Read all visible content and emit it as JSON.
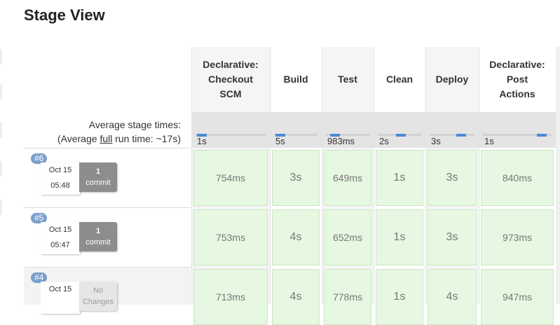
{
  "page": {
    "title": "Stage View"
  },
  "average": {
    "line1": "Average stage times:",
    "line2_pre": "(Average ",
    "line2_link": "full",
    "line2_post": " run time: ~17s)"
  },
  "stages": [
    {
      "name_lines": [
        "Declarative:",
        "Checkout",
        "SCM"
      ],
      "avg": "1s"
    },
    {
      "name_lines": [
        "Build"
      ],
      "avg": "5s"
    },
    {
      "name_lines": [
        "Test"
      ],
      "avg": "983ms"
    },
    {
      "name_lines": [
        "Clean"
      ],
      "avg": "2s"
    },
    {
      "name_lines": [
        "Deploy"
      ],
      "avg": "3s"
    },
    {
      "name_lines": [
        "Declarative:",
        "Post",
        "Actions"
      ],
      "avg": "1s"
    }
  ],
  "builds": [
    {
      "number": "#6",
      "date": "Oct 15",
      "time": "05:48",
      "changes_count": "1",
      "changes_label": "commit",
      "no_changes": false,
      "times": [
        "754ms",
        "3s",
        "649ms",
        "1s",
        "3s",
        "840ms"
      ]
    },
    {
      "number": "#5",
      "date": "Oct 15",
      "time": "05:47",
      "changes_count": "1",
      "changes_label": "commit",
      "no_changes": false,
      "times": [
        "753ms",
        "4s",
        "652ms",
        "1s",
        "3s",
        "973ms"
      ]
    },
    {
      "number": "#4",
      "date": "Oct 15",
      "time": "",
      "changes_count": "No",
      "changes_label": "Changes",
      "no_changes": true,
      "times": [
        "713ms",
        "4s",
        "778ms",
        "1s",
        "4s",
        "947ms"
      ]
    }
  ],
  "colors": {
    "success_cell": "#e6f8e1",
    "success_border": "#c9e8c0",
    "badge": "#7a9fcb",
    "progress": "#4a8ad4"
  }
}
